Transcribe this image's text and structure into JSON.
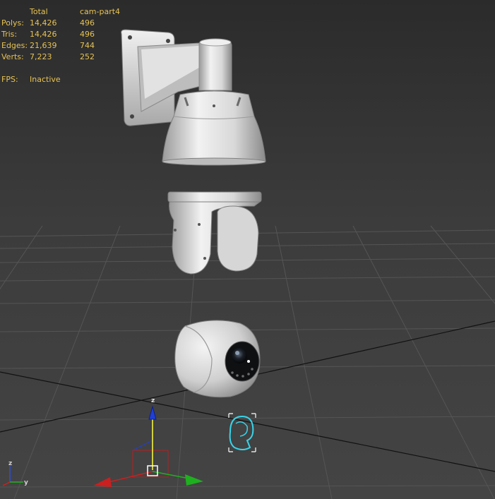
{
  "stats": {
    "header": [
      "",
      "Total",
      "cam-part4"
    ],
    "rows": [
      {
        "label": "Polys:",
        "total": "14,426",
        "selected": "496"
      },
      {
        "label": "Tris:",
        "total": "14,426",
        "selected": "496"
      },
      {
        "label": "Edges:",
        "total": "21,639",
        "selected": "744"
      },
      {
        "label": "Verts:",
        "total": "7,223",
        "selected": "252"
      }
    ]
  },
  "fps": {
    "label": "FPS:",
    "value": "Inactive"
  },
  "gizmo": {
    "z_label": "z"
  },
  "view_axes": {
    "z_label": "z",
    "y_label": "y"
  },
  "colors": {
    "stats_text": "#e6c254",
    "grid": "#525252",
    "x_axis": "#cc1f1f",
    "y_axis": "#1fb01f",
    "z_axis": "#1f3fd6",
    "selection": "#39d3e8",
    "model": "#d9d9d9"
  },
  "scene": {
    "objects": [
      "wall-mount-arm",
      "camera-housing",
      "pan-bracket",
      "camera-ball",
      "cam-part4"
    ],
    "selected_object": "cam-part4"
  }
}
